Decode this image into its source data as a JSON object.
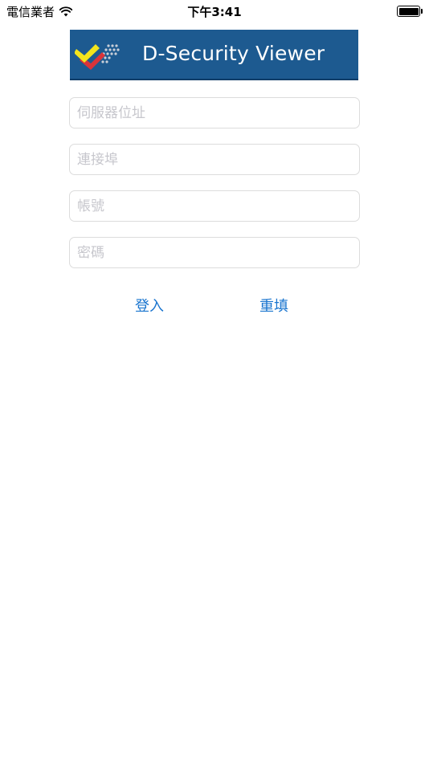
{
  "status_bar": {
    "carrier": "電信業者",
    "time": "下午3:41",
    "wifi_icon": "wifi-icon",
    "battery_icon": "battery-icon",
    "battery_level": 1.0
  },
  "banner": {
    "title": "D-Security Viewer",
    "background_color": "#1d5a90",
    "logo_icon": "dsecurity-logo-icon"
  },
  "form": {
    "server": {
      "placeholder": "伺服器位址",
      "value": ""
    },
    "port": {
      "placeholder": "連接埠",
      "value": ""
    },
    "account": {
      "placeholder": "帳號",
      "value": ""
    },
    "password": {
      "placeholder": "密碼",
      "value": ""
    }
  },
  "actions": {
    "login_label": "登入",
    "reset_label": "重填",
    "accent_color": "#1a75cf"
  }
}
